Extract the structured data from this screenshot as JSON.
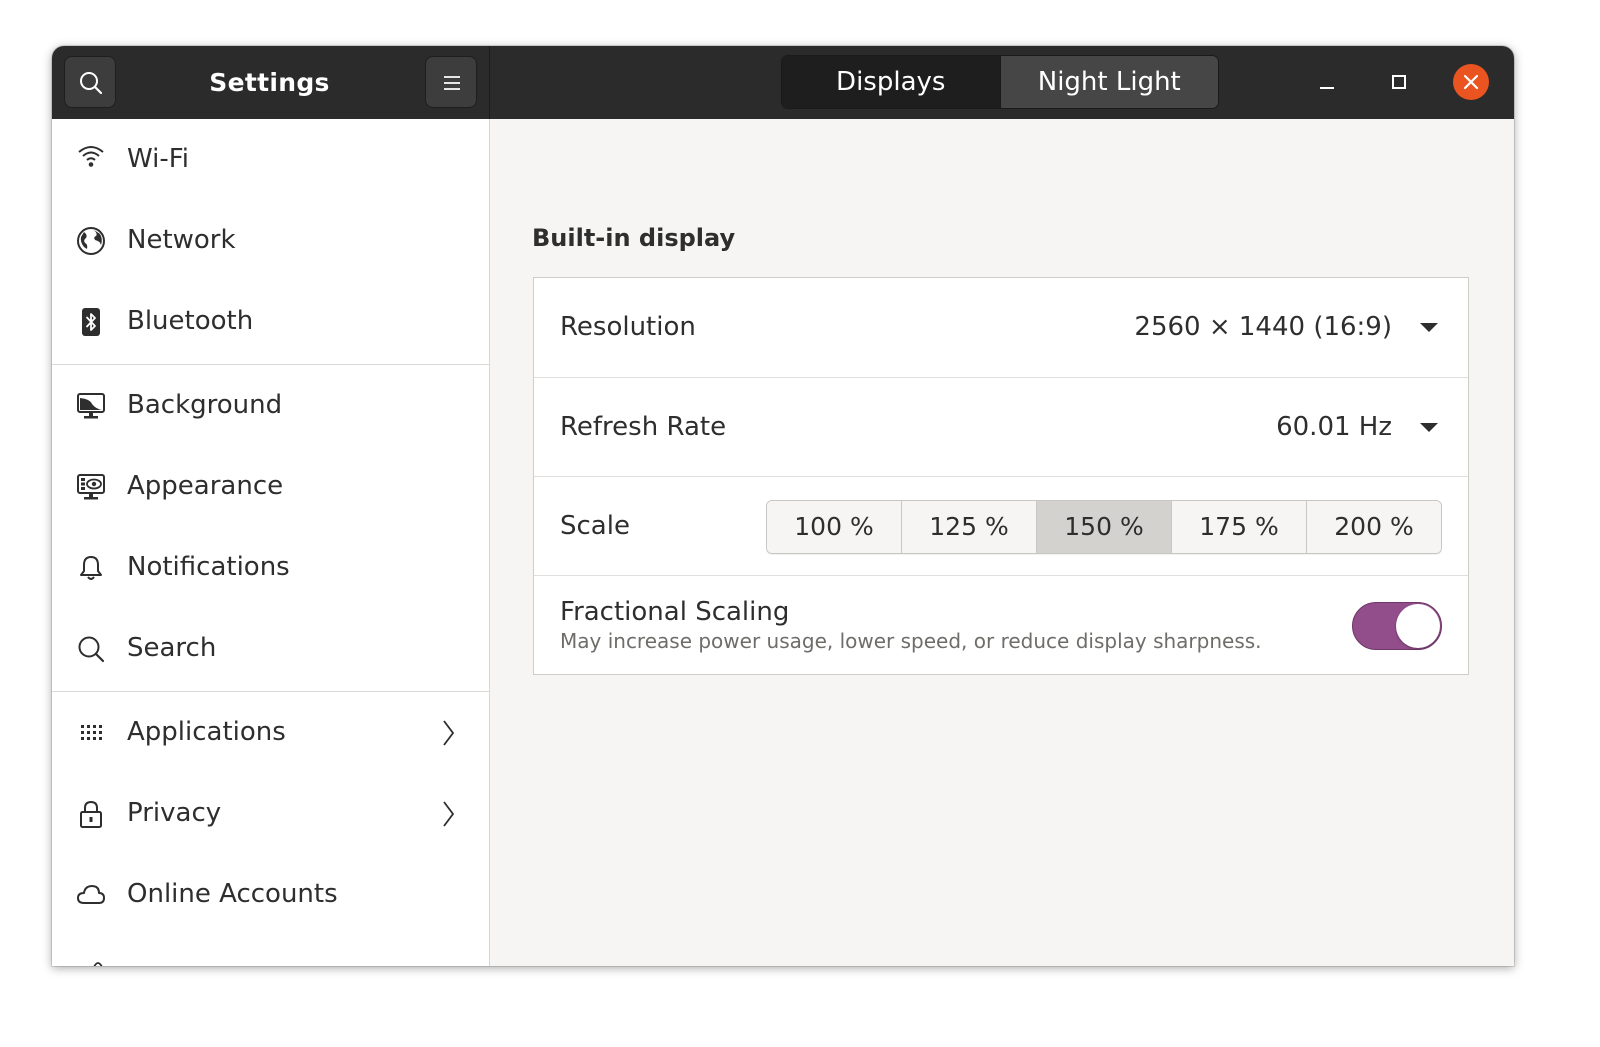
{
  "header": {
    "title": "Settings",
    "search_icon": "search-icon",
    "menu_icon": "hamburger-menu-icon",
    "tabs": [
      {
        "label": "Displays",
        "active": true
      },
      {
        "label": "Night Light",
        "active": false
      }
    ],
    "window_controls": [
      "minimize-icon",
      "maximize-icon",
      "close-icon"
    ],
    "close_color": "#e95420"
  },
  "sidebar": {
    "items": [
      {
        "label": "Wi-Fi",
        "icon": "wifi-icon"
      },
      {
        "label": "Network",
        "icon": "globe-icon"
      },
      {
        "label": "Bluetooth",
        "icon": "bluetooth-icon"
      },
      {
        "label": "Background",
        "icon": "monitor-background-icon"
      },
      {
        "label": "Appearance",
        "icon": "appearance-icon"
      },
      {
        "label": "Notifications",
        "icon": "bell-icon"
      },
      {
        "label": "Search",
        "icon": "search-icon"
      },
      {
        "label": "Applications",
        "icon": "apps-grid-icon",
        "has_submenu": true
      },
      {
        "label": "Privacy",
        "icon": "lock-icon",
        "has_submenu": true
      },
      {
        "label": "Online Accounts",
        "icon": "cloud-icon"
      }
    ]
  },
  "main": {
    "section_title": "Built-in display",
    "resolution": {
      "label": "Resolution",
      "value": "2560 × 1440 (16:9)"
    },
    "refresh_rate": {
      "label": "Refresh Rate",
      "value": "60.01 Hz"
    },
    "scale": {
      "label": "Scale",
      "options": [
        "100 %",
        "125 %",
        "150 %",
        "175 %",
        "200 %"
      ],
      "selected": "150 %"
    },
    "fractional_scaling": {
      "title": "Fractional Scaling",
      "subtitle": "May increase power usage, lower speed, or reduce display sharpness.",
      "enabled": true,
      "accent_color": "#924d8b"
    }
  }
}
